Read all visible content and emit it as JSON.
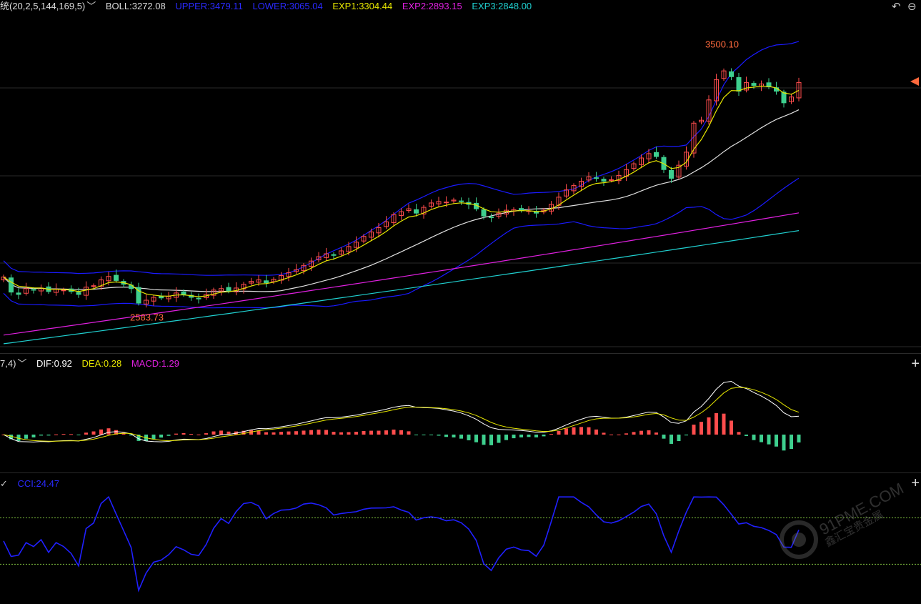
{
  "main_legend": {
    "indicator": "统(20,2,5,144,169,5)",
    "boll": "BOLL:3272.08",
    "upper": "UPPER:3479.11",
    "lower": "LOWER:3065.04",
    "exp1": "EXP1:3304.44",
    "exp2": "EXP2:2893.15",
    "exp3": "EXP3:2848.00"
  },
  "macd_legend": {
    "params": "7,4)",
    "dif": "DIF:0.92",
    "dea": "DEA:0.28",
    "macd": "MACD:1.29"
  },
  "cci_legend": {
    "cci": "CCI:24.47"
  },
  "annotations": {
    "high": "3500.10",
    "low": "2583.73"
  },
  "watermark": {
    "text": "91PME.COM",
    "sub": "鑫汇宝贵金属"
  },
  "colors": {
    "up": "#ff4d4d",
    "down": "#3ecf8e",
    "boll_mid": "#e0e0e0",
    "upper_lower": "#1a1aff",
    "exp1": "#e6e600",
    "exp2": "#e020e0",
    "exp3": "#20d0d0",
    "cci": "#2020ff",
    "dif": "#ffffff",
    "dea": "#e6e600",
    "cci_ref": "#7fbf3f"
  },
  "chart_data": [
    {
      "type": "candlestick",
      "title": "",
      "high_marker": 3500.1,
      "low_marker": 2583.73,
      "current_values": {
        "BOLL": 3272.08,
        "UPPER": 3479.11,
        "LOWER": 3065.04,
        "EXP1": 3304.44,
        "EXP2": 2893.15,
        "EXP3": 2848.0
      },
      "ylim": [
        2460,
        3600
      ],
      "closes": [
        2700,
        2648,
        2640,
        2660,
        2655,
        2662,
        2650,
        2658,
        2655,
        2650,
        2640,
        2665,
        2670,
        2690,
        2702,
        2688,
        2675,
        2660,
        2610,
        2620,
        2630,
        2628,
        2633,
        2645,
        2640,
        2630,
        2625,
        2640,
        2655,
        2660,
        2652,
        2662,
        2675,
        2685,
        2690,
        2680,
        2692,
        2705,
        2715,
        2725,
        2740,
        2755,
        2770,
        2780,
        2775,
        2790,
        2805,
        2820,
        2840,
        2855,
        2870,
        2890,
        2915,
        2925,
        2935,
        2920,
        2940,
        2955,
        2960,
        2958,
        2965,
        2960,
        2950,
        2935,
        2910,
        2905,
        2920,
        2930,
        2932,
        2930,
        2928,
        2920,
        2930,
        2950,
        2975,
        3000,
        3015,
        3030,
        3045,
        3040,
        3030,
        3035,
        3050,
        3070,
        3090,
        3110,
        3125,
        3115,
        3070,
        3040,
        3085,
        3130,
        3230,
        3240,
        3310,
        3380,
        3410,
        3390,
        3340,
        3370,
        3360,
        3365,
        3355,
        3340,
        3300,
        3320,
        3370
      ]
    },
    {
      "type": "bar+line",
      "title": "",
      "series": [
        {
          "name": "DIF",
          "current": 0.92
        },
        {
          "name": "DEA",
          "current": 0.28
        },
        {
          "name": "MACD",
          "current": 1.29
        }
      ]
    },
    {
      "type": "line",
      "title": "",
      "series": [
        {
          "name": "CCI",
          "current": 24.47
        }
      ],
      "reference_lines": [
        100,
        -100
      ],
      "ylim": [
        -250,
        200
      ]
    }
  ]
}
